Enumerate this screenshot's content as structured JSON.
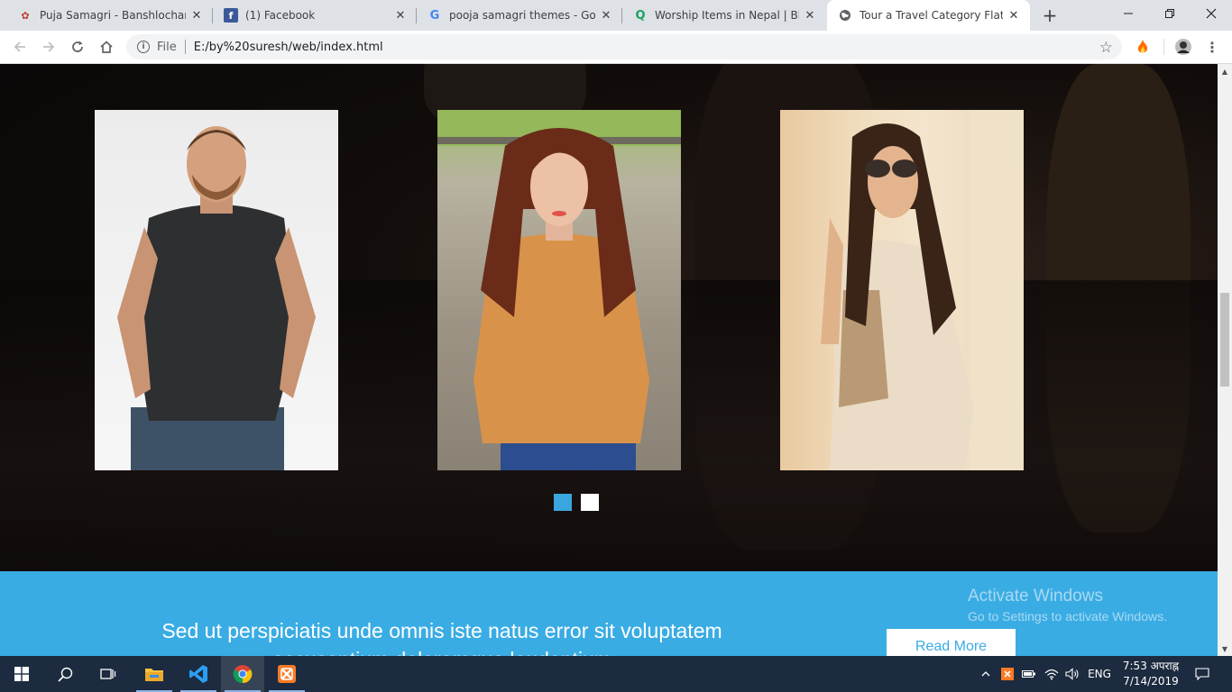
{
  "browser": {
    "tabs": [
      {
        "title": "Puja Samagri - Banshlochan Pu",
        "favicon": "red-flower-icon",
        "color": "#c0392b"
      },
      {
        "title": "(1) Facebook",
        "favicon": "facebook-icon",
        "color": "#3b5998"
      },
      {
        "title": "pooja samagri themes - Googl",
        "favicon": "google-icon",
        "color": "#4285f4"
      },
      {
        "title": "Worship Items in Nepal | Bheti",
        "favicon": "bheti-icon",
        "color": "#1aa260"
      },
      {
        "title": "Tour a Travel Category Flat Boo",
        "favicon": "globe-icon",
        "color": "#5f6368",
        "active": true
      }
    ],
    "address": {
      "scheme_label": "File",
      "url": "E:/by%20suresh/web/index.html"
    }
  },
  "page": {
    "team_photos": [
      {
        "alt": "man in black t-shirt"
      },
      {
        "alt": "woman in orange sweater"
      },
      {
        "alt": "woman in sunglasses"
      }
    ],
    "carousel_dots": 2,
    "active_dot": 0,
    "cta": {
      "headline": "Sed ut perspiciatis unde omnis iste natus error sit voluptatem accusantium doloremque laudantium",
      "button_label": "Read More"
    },
    "watermark": {
      "title": "Activate Windows",
      "subtitle": "Go to Settings to activate Windows."
    },
    "colors": {
      "accent": "#3aace4",
      "active_dot": "#3aa6e0"
    }
  },
  "taskbar": {
    "lang": "ENG",
    "time": "7:53 अपराह्न",
    "date": "7/14/2019"
  }
}
